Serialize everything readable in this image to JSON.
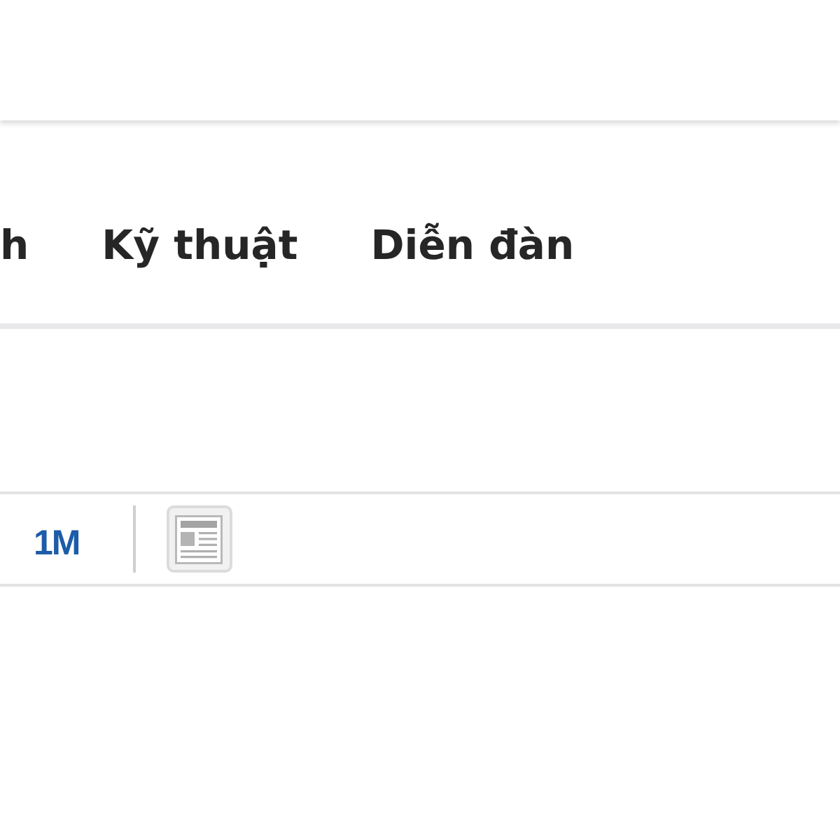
{
  "nav": {
    "items": [
      {
        "label": "h"
      },
      {
        "label": "Kỹ thuật"
      },
      {
        "label": "Diễn đàn"
      }
    ]
  },
  "toolbar": {
    "ranges": [
      {
        "label": "1M"
      }
    ]
  }
}
